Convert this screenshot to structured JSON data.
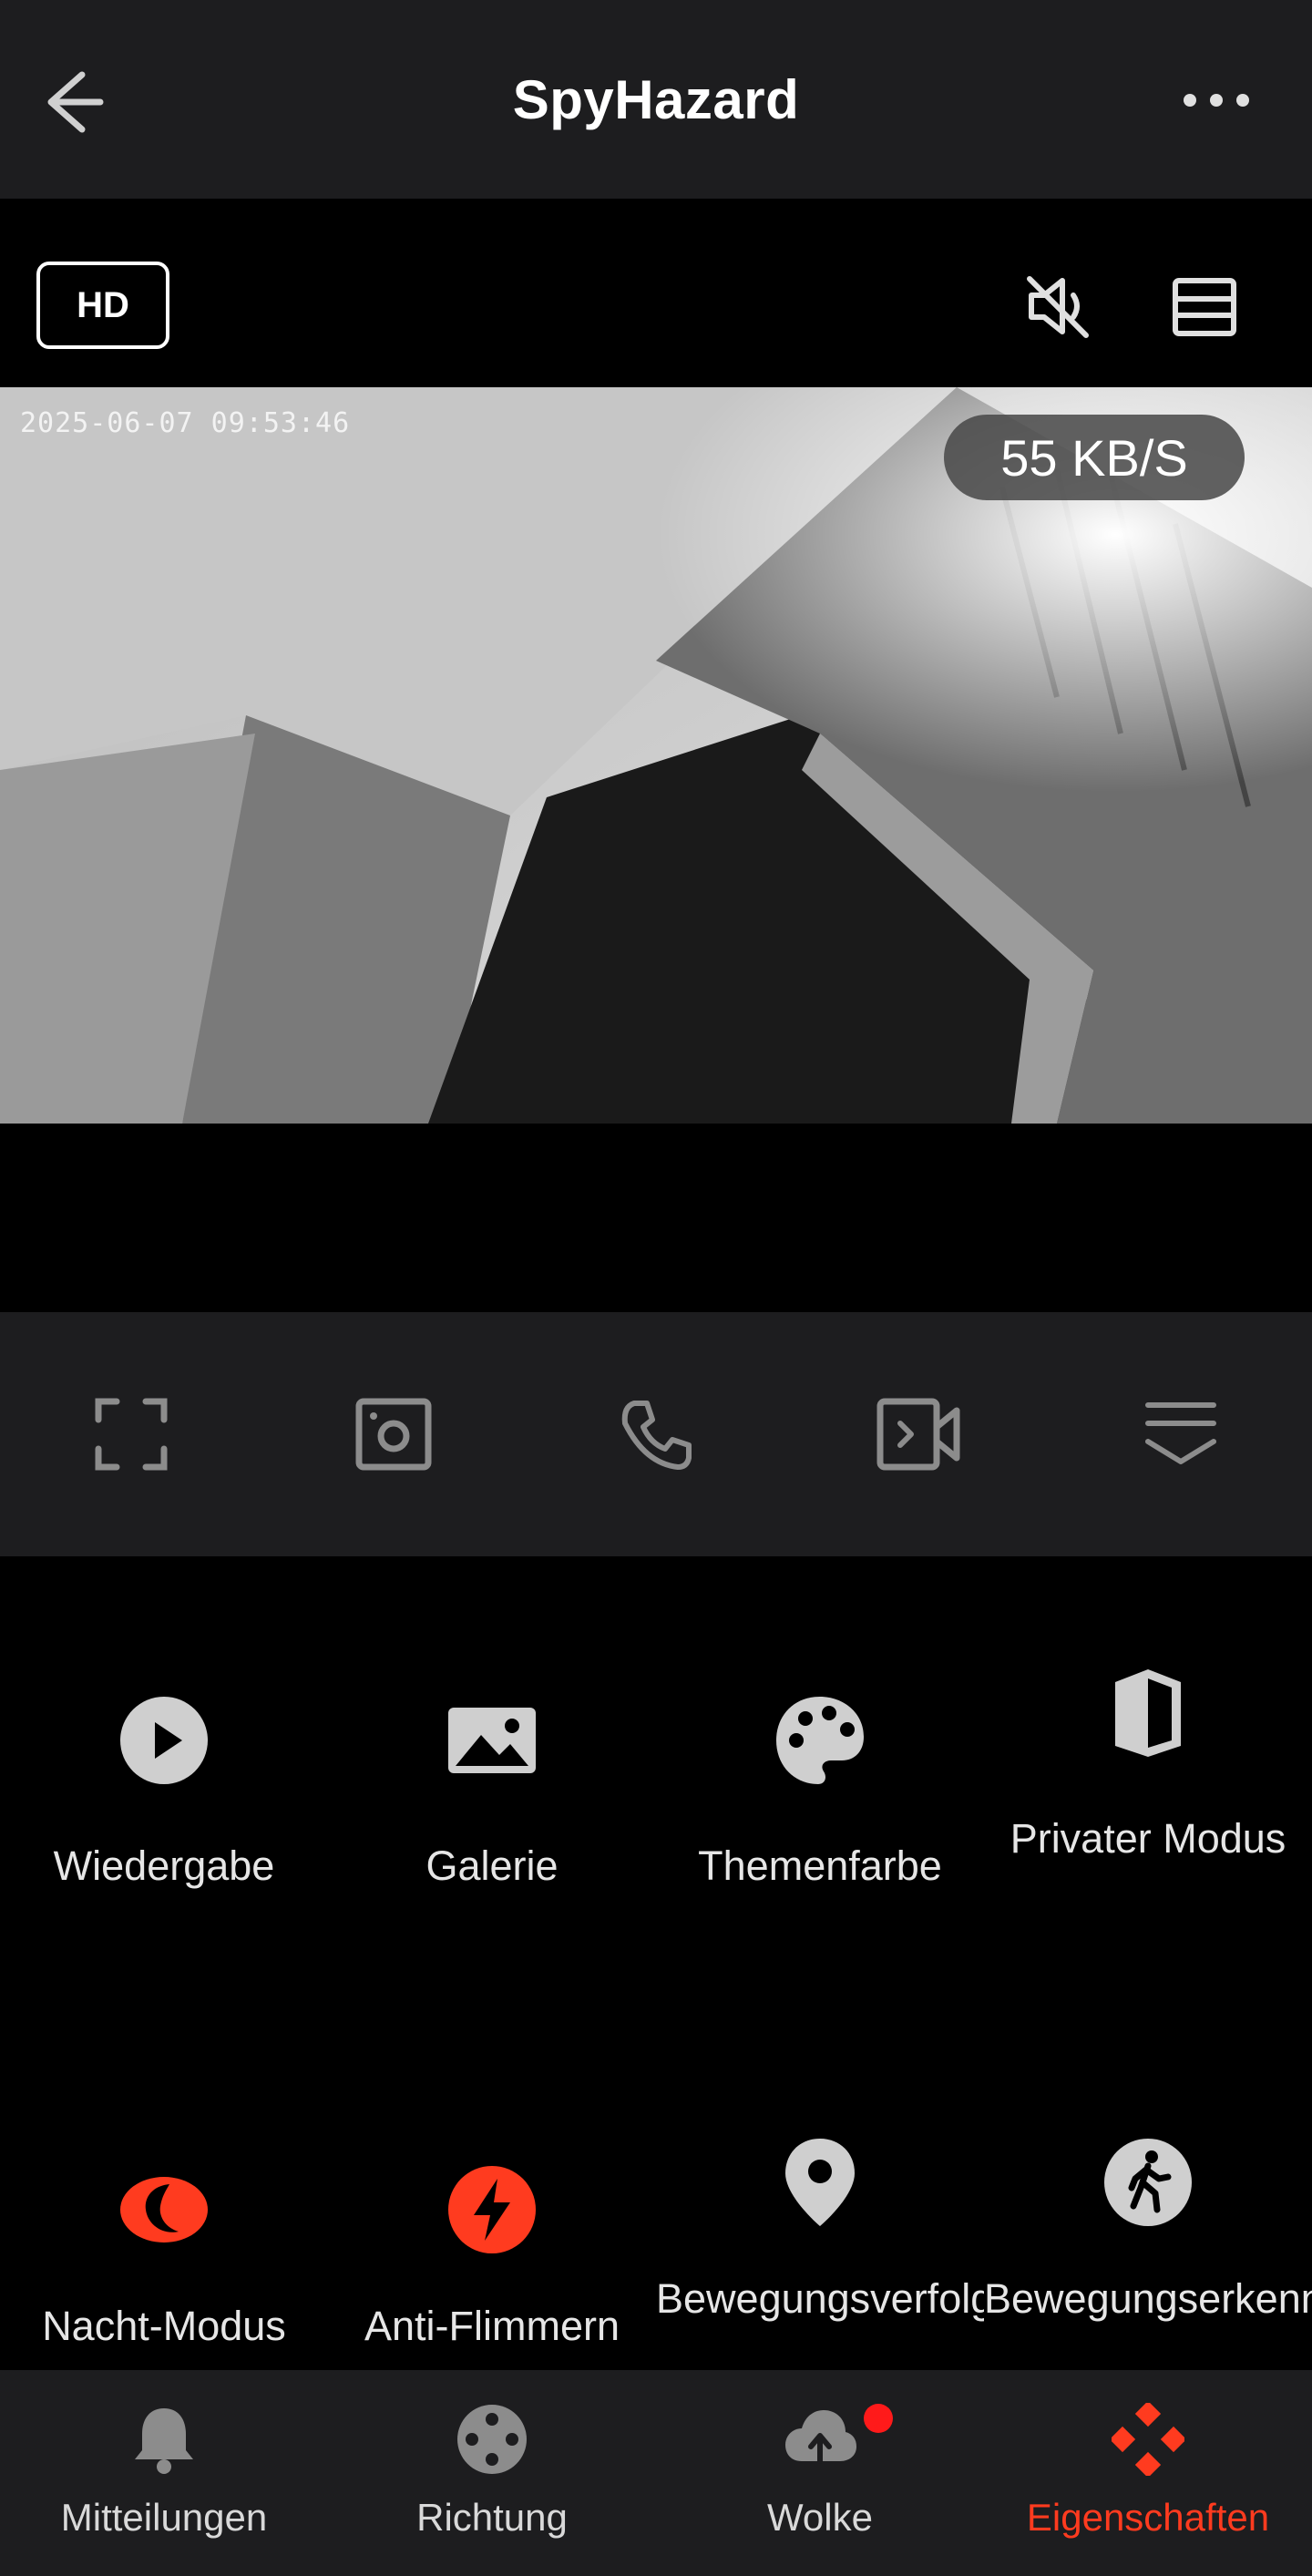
{
  "header": {
    "title": "SpyHazard",
    "back_icon": "arrow-left-icon",
    "more_icon": "more-horizontal-icon"
  },
  "stream": {
    "quality": "HD",
    "timestamp": "2025-06-07 09:53:46",
    "bitrate": "55 KB/S",
    "mute_icon": "speaker-muted-icon",
    "layout_icon": "layout-rows-icon"
  },
  "toolbar": {
    "items": [
      {
        "name": "fullscreen-icon"
      },
      {
        "name": "screenshot-icon"
      },
      {
        "name": "phone-icon"
      },
      {
        "name": "record-video-icon"
      },
      {
        "name": "collapse-icon"
      }
    ]
  },
  "features": [
    {
      "label": "Wiedergabe",
      "icon": "play-icon",
      "active": false
    },
    {
      "label": "Galerie",
      "icon": "image-icon",
      "active": false
    },
    {
      "label": "Themenfarbe",
      "icon": "palette-icon",
      "active": false
    },
    {
      "label": "Privater Modus",
      "icon": "shield-icon",
      "active": false
    },
    {
      "label": "Nacht-Modus",
      "icon": "moon-icon",
      "active": true
    },
    {
      "label": "Anti-Flimmern",
      "icon": "lightning-icon",
      "active": true
    },
    {
      "label": "Bewegungsverfolgung",
      "icon": "location-pin-icon",
      "active": false
    },
    {
      "label": "Bewegungserkennung",
      "icon": "walking-person-icon",
      "active": false
    }
  ],
  "bottom_nav": [
    {
      "label": "Mitteilungen",
      "icon": "bell-icon",
      "active": false
    },
    {
      "label": "Richtung",
      "icon": "direction-pad-icon",
      "active": false
    },
    {
      "label": "Wolke",
      "icon": "cloud-upload-icon",
      "active": false,
      "badge": true
    },
    {
      "label": "Eigenschaften",
      "icon": "diamond-grid-icon",
      "active": true
    }
  ],
  "colors": {
    "accent": "#ff3b1f",
    "panel": "#1d1d1f",
    "background": "#000000",
    "icon_gray": "#cfcfcf"
  }
}
